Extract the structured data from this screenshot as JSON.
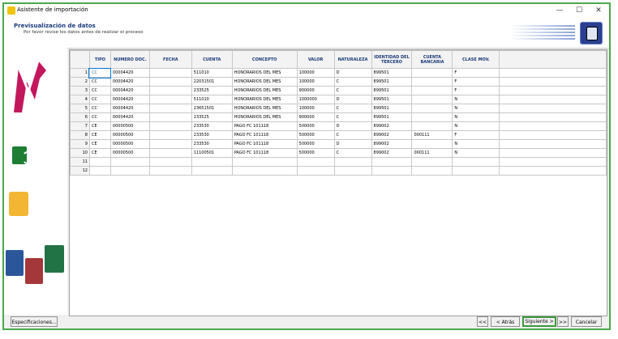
{
  "window": {
    "title": "Asistente de importación",
    "minimize": "—",
    "maximize": "☐",
    "close": "✕"
  },
  "header": {
    "title": "Previsualización de datos",
    "subtitle": "Por favor revise los datos antes de realizar el proceso"
  },
  "table": {
    "columns": [
      "TIPO",
      "NUMERO DOC.",
      "FECHA",
      "CUENTA",
      "CONCEPTO",
      "VALOR",
      "NATURALEZA",
      "IDENTIDAD DEL TERCERO",
      "CUENTA BANCARIA",
      "CLASE MOV."
    ],
    "rows": [
      {
        "n": "1",
        "cells": [
          "CC",
          "00004420",
          "",
          "511010",
          "HONORARIOS DEL MES",
          "100000",
          "D",
          "899501",
          "",
          "F"
        ]
      },
      {
        "n": "2",
        "cells": [
          "CC",
          "00004420",
          "",
          "22031501",
          "HONORARIOS DEL MES",
          "100000",
          "C",
          "899501",
          "",
          "F"
        ]
      },
      {
        "n": "3",
        "cells": [
          "CC",
          "00004420",
          "",
          "233525",
          "HONORARIOS DEL MES",
          "900000",
          "C",
          "899501",
          "",
          "F"
        ]
      },
      {
        "n": "4",
        "cells": [
          "CC",
          "00004420",
          "",
          "511010",
          "HONORARIOS DEL MES",
          "1000000",
          "D",
          "899501",
          "",
          "N"
        ]
      },
      {
        "n": "5",
        "cells": [
          "CC",
          "00004420",
          "",
          "23651501",
          "HONORARIOS DEL MES",
          "100000",
          "C",
          "899501",
          "",
          "N"
        ]
      },
      {
        "n": "6",
        "cells": [
          "CC",
          "00004420",
          "",
          "233525",
          "HONORARIOS DEL MES",
          "900000",
          "C",
          "899501",
          "",
          "N"
        ]
      },
      {
        "n": "7",
        "cells": [
          "CE",
          "00000500",
          "",
          "233530",
          "PAGO FC 101118",
          "500000",
          "D",
          "899002",
          "",
          "N"
        ]
      },
      {
        "n": "8",
        "cells": [
          "CE",
          "00000500",
          "",
          "233530",
          "PAGO FC 101118",
          "500000",
          "C",
          "899002",
          "000111",
          "F"
        ]
      },
      {
        "n": "9",
        "cells": [
          "CE",
          "00000500",
          "",
          "233530",
          "PAGO FC 101118",
          "500000",
          "D",
          "899002",
          "",
          "N"
        ]
      },
      {
        "n": "10",
        "cells": [
          "CE",
          "00000500",
          "",
          "11100501",
          "PAGO FC 101118",
          "500000",
          "C",
          "899002",
          "000111",
          "N"
        ]
      },
      {
        "n": "11",
        "cells": [
          "",
          "",
          "",
          "",
          "",
          "",
          "",
          "",
          "",
          ""
        ]
      },
      {
        "n": "12",
        "cells": [
          "",
          "",
          "",
          "",
          "",
          "",
          "",
          "",
          "",
          ""
        ]
      }
    ]
  },
  "footer": {
    "especificaciones": "Especificaciones...",
    "first": "<<",
    "atras": "< Atrás",
    "siguiente": "Siguiente >",
    "last": ">>",
    "cancelar": "Cancelar"
  },
  "colors": {
    "accent_border": "#3a9a3a",
    "header_title": "#1a3a7a"
  }
}
